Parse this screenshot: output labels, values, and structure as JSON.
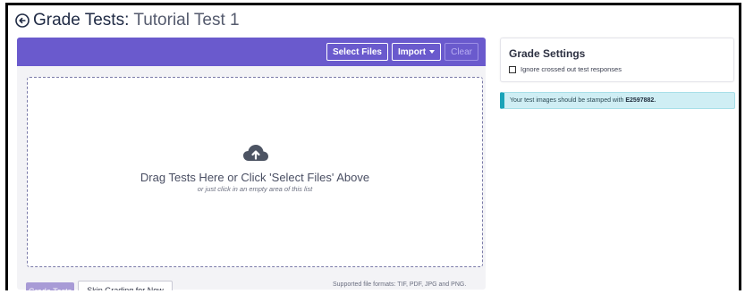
{
  "header": {
    "title_strong": "Grade Tests:",
    "title_sub": "Tutorial Test 1"
  },
  "toolbar": {
    "select_files": "Select Files",
    "import": "Import",
    "clear": "Clear"
  },
  "dropzone": {
    "title": "Drag Tests Here or Click 'Select Files' Above",
    "subtitle": "or just click in an empty area of this list"
  },
  "footer": {
    "formats": "Supported file formats: TIF, PDF, JPG and PNG.",
    "grade_button": "Grade Tests",
    "skip_button": "Skip Grading for Now"
  },
  "settings": {
    "title": "Grade Settings",
    "option_label": "Ignore crossed out test responses",
    "option_checked": false
  },
  "alert": {
    "text": "Your test images should be stamped with",
    "code": "E2597882."
  },
  "colors": {
    "toolbar_accent": "#6a5acd",
    "grade_button": "#a89bd6",
    "info_bg": "#cfeef4",
    "info_border": "#1aa3b8"
  },
  "icons": {
    "back": "back-arrow-circle-icon",
    "upload": "cloud-upload-icon",
    "caret": "caret-down-icon"
  }
}
